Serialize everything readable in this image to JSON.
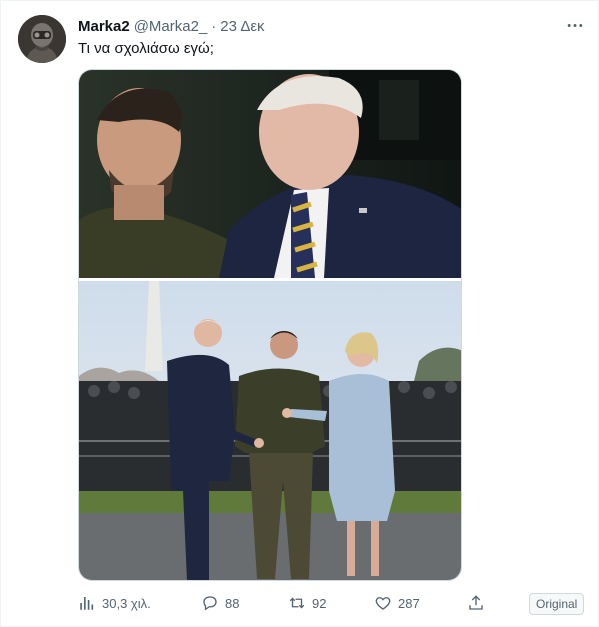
{
  "tweet": {
    "display_name": "Marka2",
    "handle": "@Marka2_",
    "separator": "·",
    "date": "23 Δεκ",
    "text": "Τι να σχολιάσω εγώ;"
  },
  "actions": {
    "views": "30,3 χιλ.",
    "replies": "88",
    "retweets": "92",
    "likes": "287"
  },
  "original_label": "Original",
  "icons": {
    "more": "more-dots-icon",
    "views": "bar-chart-icon",
    "reply": "reply-bubble-icon",
    "retweet": "retweet-icon",
    "like": "heart-icon",
    "share": "share-icon"
  },
  "colors": {
    "text_primary": "#0f1419",
    "text_secondary": "#536471",
    "border": "#cfd9de"
  }
}
